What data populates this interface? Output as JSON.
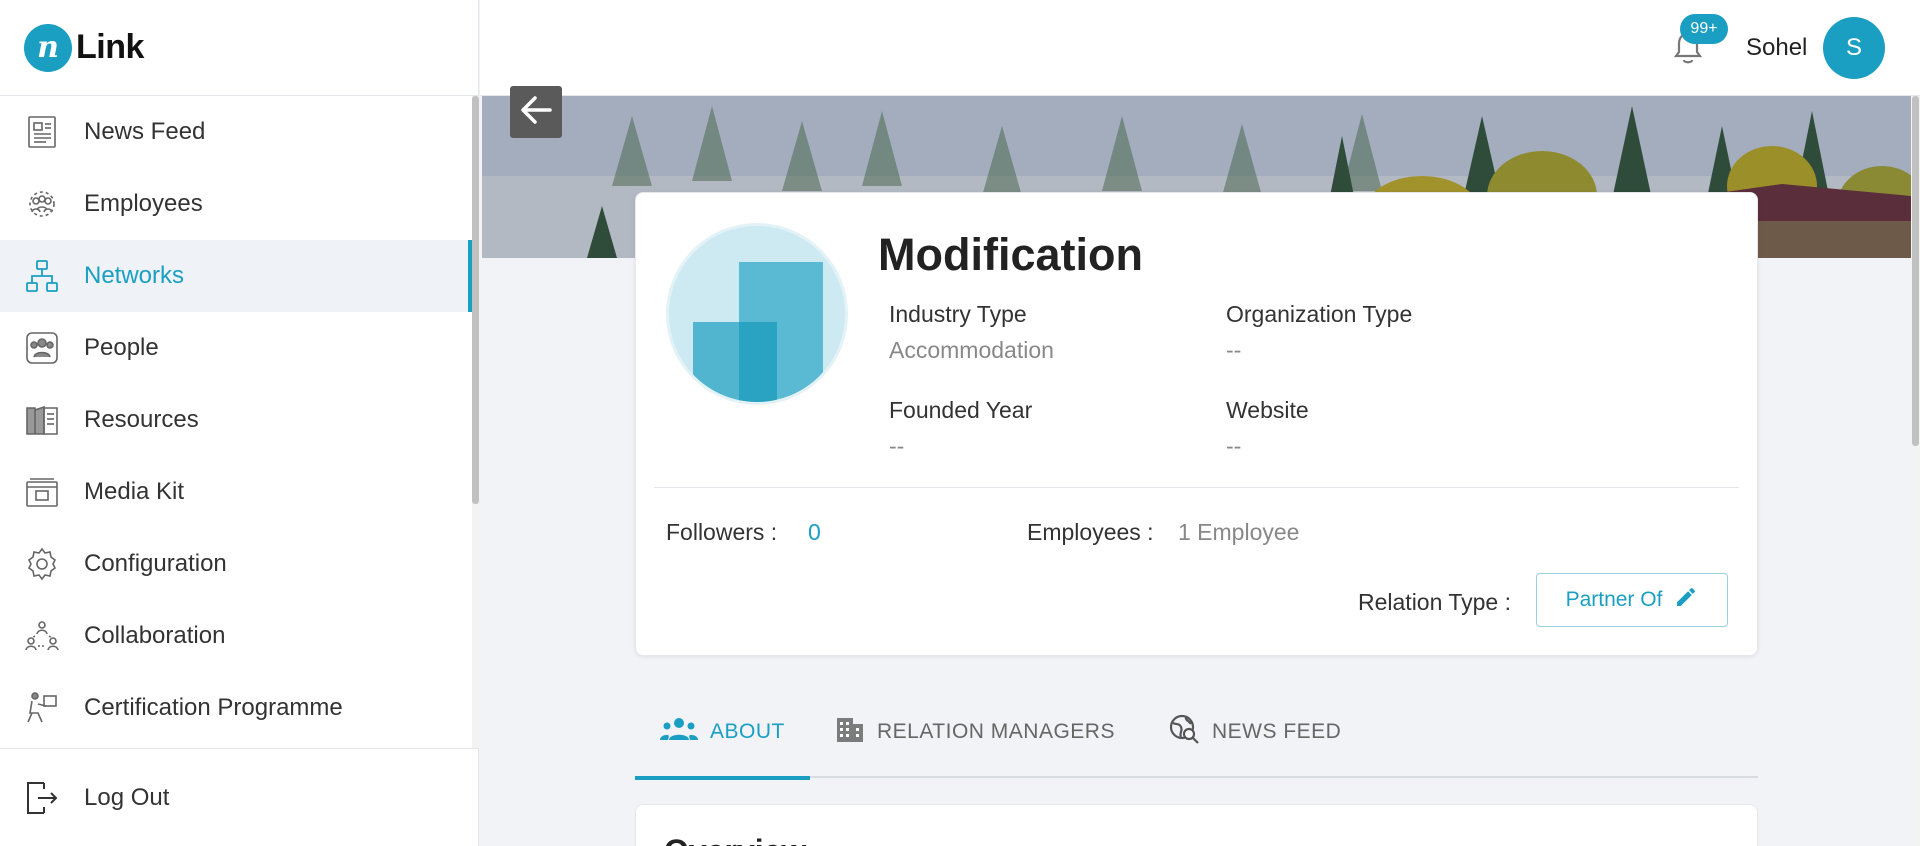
{
  "brand": {
    "logo_mark": "n",
    "logo_text": "Link"
  },
  "sidebar": {
    "items": [
      {
        "label": "News Feed",
        "icon": "newspaper-icon",
        "active": false
      },
      {
        "label": "Employees",
        "icon": "employees-icon",
        "active": false
      },
      {
        "label": "Networks",
        "icon": "network-icon",
        "active": true
      },
      {
        "label": "People",
        "icon": "people-icon",
        "active": false
      },
      {
        "label": "Resources",
        "icon": "book-icon",
        "active": false
      },
      {
        "label": "Media Kit",
        "icon": "media-kit-icon",
        "active": false
      },
      {
        "label": "Configuration",
        "icon": "gear-icon",
        "active": false
      },
      {
        "label": "Collaboration",
        "icon": "collaboration-icon",
        "active": false
      },
      {
        "label": "Certification Programme",
        "icon": "certification-icon",
        "active": false
      }
    ],
    "logout_label": "Log Out"
  },
  "header": {
    "notification_count": "99+",
    "username": "Sohel",
    "avatar_initial": "S"
  },
  "profile": {
    "name": "Modification",
    "industry_type_label": "Industry Type",
    "industry_type_value": "Accommodation",
    "organization_type_label": "Organization Type",
    "organization_type_value": "--",
    "founded_year_label": "Founded Year",
    "founded_year_value": "--",
    "website_label": "Website",
    "website_value": "--",
    "followers_label": "Followers :",
    "followers_value": "0",
    "employees_label": "Employees :",
    "employees_value": "1 Employee",
    "relation_type_label": "Relation Type :",
    "relation_type_value": "Partner Of"
  },
  "tabs": [
    {
      "label": "ABOUT",
      "icon": "group-icon",
      "active": true
    },
    {
      "label": "RELATION MANAGERS",
      "icon": "building-icon",
      "active": false
    },
    {
      "label": "NEWS FEED",
      "icon": "globe-search-icon",
      "active": false
    }
  ],
  "overview": {
    "title": "Overview"
  },
  "colors": {
    "accent": "#1a9fc2",
    "active_bg": "#eff2f6"
  }
}
